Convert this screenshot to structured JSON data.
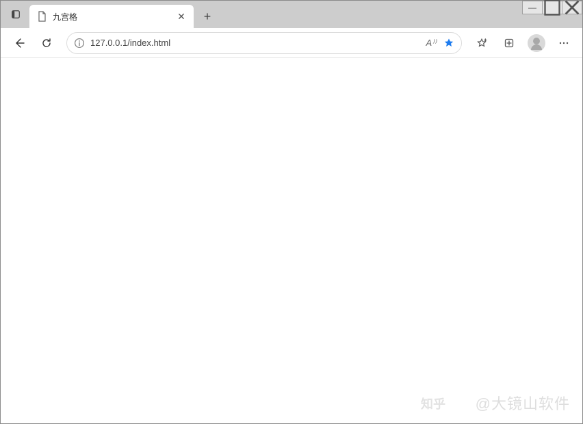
{
  "window": {
    "controls": {
      "minimize": "—",
      "maximize": "□",
      "close": "✕"
    }
  },
  "tab": {
    "title": "九宫格",
    "close": "✕"
  },
  "new_tab": "+",
  "address": {
    "url": "127.0.0.1/index.html",
    "reading_label": "A⁾⁾"
  },
  "watermark": {
    "zhihu": "知乎",
    "text": "@大镜山软件"
  }
}
